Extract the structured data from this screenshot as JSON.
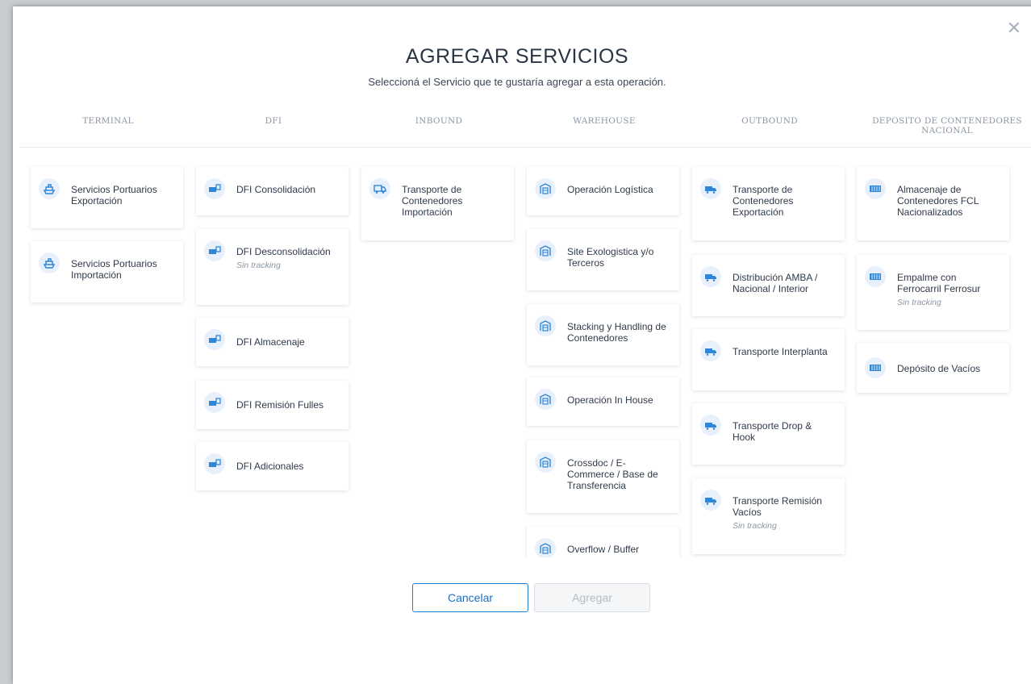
{
  "modal": {
    "title": "AGREGAR SERVICIOS",
    "subtitle": "Seleccioná el Servicio que te gustaría agregar a esta operación.",
    "close_icon": "close-icon"
  },
  "columns": [
    {
      "header": "TERMINAL",
      "icon": "ship-icon"
    },
    {
      "header": "DFI",
      "icon": "truck-doc-icon"
    },
    {
      "header": "INBOUND",
      "icon": "truck-icon"
    },
    {
      "header": "WAREHOUSE",
      "icon": "warehouse-icon"
    },
    {
      "header": "OUTBOUND",
      "icon": "delivery-truck-icon"
    },
    {
      "header": "DEPOSITO DE CONTENEDORES NACIONAL",
      "icon": "container-icon"
    }
  ],
  "cards": {
    "terminal": [
      {
        "label": "Servicios Portuarios Exportación"
      },
      {
        "label": "Servicios Portuarios Importación"
      }
    ],
    "dfi": [
      {
        "label": "DFI Consolidación"
      },
      {
        "label": "DFI Desconsolidación",
        "note": "Sin tracking"
      },
      {
        "label": "DFI Almacenaje"
      },
      {
        "label": "DFI Remisión Fulles"
      },
      {
        "label": "DFI Adicionales"
      }
    ],
    "inbound": [
      {
        "label": "Transporte de Contenedores Importación"
      }
    ],
    "warehouse": [
      {
        "label": "Operación Logística"
      },
      {
        "label": "Site Exologistica y/o Terceros"
      },
      {
        "label": "Stacking y Handling de Contenedores"
      },
      {
        "label": "Operación In House"
      },
      {
        "label": "Crossdoc / E-Commerce / Base de Transferencia"
      },
      {
        "label": "Overflow / Buffer"
      }
    ],
    "outbound": [
      {
        "label": "Transporte de Contenedores Exportación"
      },
      {
        "label": "Distribución AMBA / Nacional / Interior"
      },
      {
        "label": "Transporte Interplanta"
      },
      {
        "label": "Transporte Drop & Hook"
      },
      {
        "label": "Transporte Remisión Vacíos",
        "note": "Sin tracking"
      }
    ],
    "deposito": [
      {
        "label": "Almacenaje de Contenedores FCL Nacionalizados"
      },
      {
        "label": "Empalme con Ferrocarril Ferrosur",
        "note": "Sin tracking"
      },
      {
        "label": "Depósito de Vacíos"
      }
    ]
  },
  "buttons": {
    "cancel": "Cancelar",
    "add": "Agregar"
  },
  "colors": {
    "accent": "#1d7fd3",
    "icon_bg": "#e8f1fb",
    "icon_fg": "#2f86d6"
  }
}
